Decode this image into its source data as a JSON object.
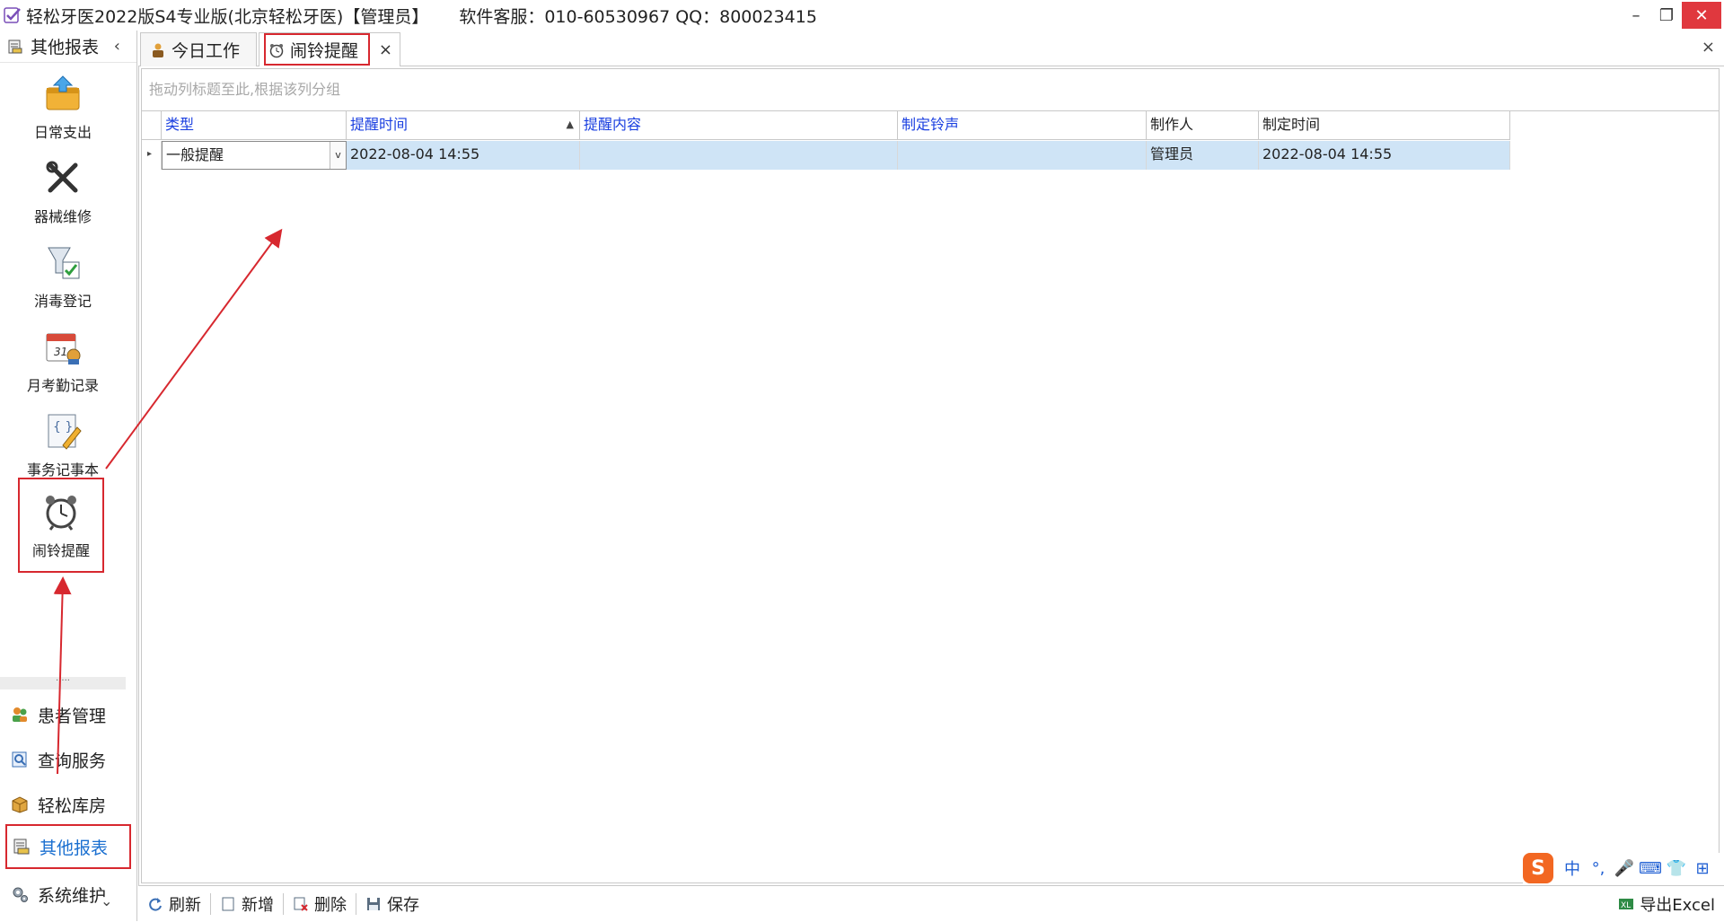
{
  "window": {
    "title": "轻松牙医2022版S4专业版(北京轻松牙医)【管理员】",
    "service": "软件客服：010-60530967 QQ：800023415",
    "controls": {
      "minimize": "–",
      "restore": "❐",
      "close": "✕"
    }
  },
  "leftnav": {
    "header_label": "其他报表",
    "collapse_glyph": "‹",
    "tools": [
      {
        "label": "日常支出",
        "icon": "expense-icon"
      },
      {
        "label": "器械维修",
        "icon": "tools-icon"
      },
      {
        "label": "消毒登记",
        "icon": "disinfect-icon"
      },
      {
        "label": "月考勤记录",
        "icon": "calendar-icon"
      },
      {
        "label": "事务记事本",
        "icon": "notebook-icon"
      },
      {
        "label": "闹铃提醒",
        "icon": "alarm-clock-icon",
        "selected": true
      }
    ],
    "splitter_text": "·····",
    "sections": [
      {
        "label": "患者管理",
        "icon": "patients-icon"
      },
      {
        "label": "查询服务",
        "icon": "query-icon"
      },
      {
        "label": "轻松库房",
        "icon": "warehouse-icon"
      },
      {
        "label": "其他报表",
        "icon": "reports-icon",
        "active": true
      },
      {
        "label": "系统维护",
        "icon": "gear-icon"
      }
    ],
    "bottom_glyph": "⌄"
  },
  "tabs": [
    {
      "label": "今日工作",
      "icon": "worker-icon",
      "active": false
    },
    {
      "label": "闹铃提醒",
      "icon": "alarm-clock-icon",
      "active": true,
      "close": "×"
    }
  ],
  "tabbar_close": "×",
  "main": {
    "group_panel_hint": "拖动列标题至此,根据该列分组",
    "columns": [
      {
        "label": "类型",
        "color": "blue"
      },
      {
        "label": "提醒时间",
        "color": "blue",
        "sort": "▲"
      },
      {
        "label": "提醒内容",
        "color": "blue"
      },
      {
        "label": "制定铃声",
        "color": "blue"
      },
      {
        "label": "制作人",
        "color": "dark"
      },
      {
        "label": "制定时间",
        "color": "dark"
      }
    ],
    "rows": [
      {
        "indicator": "▸",
        "type": "一般提醒",
        "type_dropdown": "v",
        "remind_time": "2022-08-04 14:55",
        "content": "",
        "ringtone": "",
        "maker": "管理员",
        "made_time": "2022-08-04 14:55"
      }
    ]
  },
  "bottombar": {
    "buttons": [
      {
        "label": "刷新",
        "icon": "refresh-icon"
      },
      {
        "label": "新增",
        "icon": "new-doc-icon"
      },
      {
        "label": "删除",
        "icon": "delete-icon"
      },
      {
        "label": "保存",
        "icon": "save-icon"
      }
    ],
    "export": {
      "label": "导出Excel",
      "icon": "excel-icon"
    }
  },
  "ime": {
    "logo": "S",
    "items": [
      "中",
      "°,",
      "🎤",
      "⌨",
      "👕",
      "⊞"
    ]
  },
  "colors": {
    "accent_blue": "#1a3fe0",
    "selection_row": "#cfe4f6",
    "annotation_red": "#d7282f",
    "active_nav_text": "#1a6fd0",
    "ime_orange": "#f26722"
  }
}
